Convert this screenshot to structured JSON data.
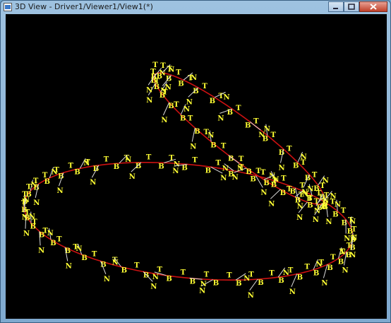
{
  "window": {
    "title": "3D View - Driver1/Viewer1/View1(*)"
  },
  "colors": {
    "background": "#000000",
    "curve": "#cc1111",
    "frame_label": "#ffff33",
    "frame_line": "#dddddd"
  },
  "frame_labels": {
    "tangent": "T",
    "binormal": "B",
    "normal": "N"
  }
}
